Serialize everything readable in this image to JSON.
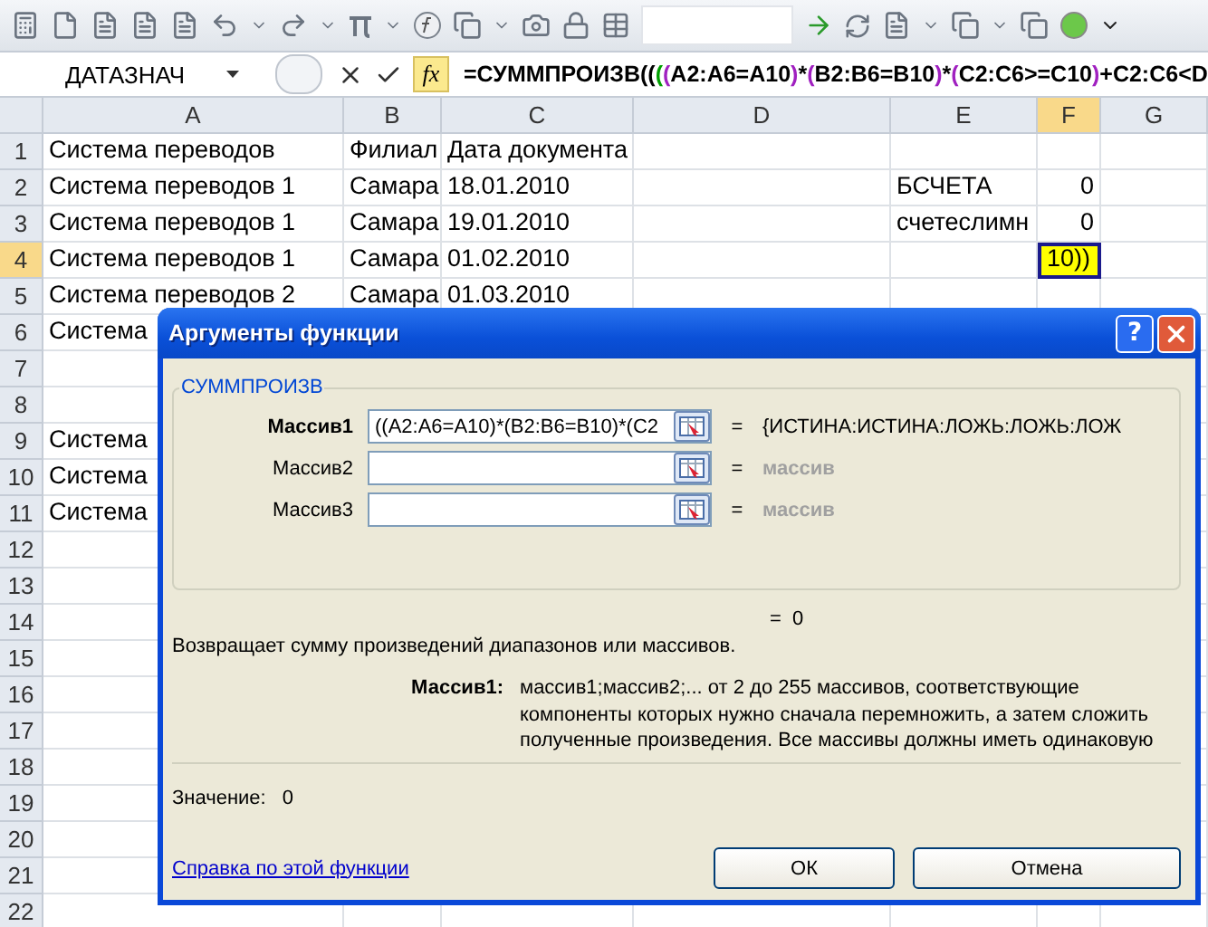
{
  "name_box": {
    "value": "ДАТАЗНАЧ"
  },
  "function_button": "fx",
  "formula": [
    {
      "text": "=СУММПРОИЗВ(",
      "color": "#000000"
    },
    {
      "text": "(",
      "color": "#000000"
    },
    {
      "text": "(",
      "color": "#00a000"
    },
    {
      "text": "(",
      "color": "#a020c0"
    },
    {
      "text": "A2:A6=A10",
      "color": "#000000"
    },
    {
      "text": ")",
      "color": "#a020c0"
    },
    {
      "text": "*",
      "color": "#000000"
    },
    {
      "text": "(",
      "color": "#a020c0"
    },
    {
      "text": "B2:B6=B10",
      "color": "#000000"
    },
    {
      "text": ")",
      "color": "#a020c0"
    },
    {
      "text": "*",
      "color": "#000000"
    },
    {
      "text": "(",
      "color": "#a020c0"
    },
    {
      "text": "C2:C6>=C10",
      "color": "#000000"
    },
    {
      "text": ")",
      "color": "#a020c0"
    },
    {
      "text": "+C2:C6<D",
      "color": "#000000"
    }
  ],
  "columns": [
    {
      "label": "A",
      "selected": false
    },
    {
      "label": "B",
      "selected": false
    },
    {
      "label": "C",
      "selected": false
    },
    {
      "label": "D",
      "selected": false
    },
    {
      "label": "E",
      "selected": false
    },
    {
      "label": "F",
      "selected": true
    },
    {
      "label": "G",
      "selected": false
    }
  ],
  "rows": [
    {
      "number": "1",
      "selected": false,
      "cells": {
        "A": "Система переводов",
        "B": "Филиал",
        "C": "Дата документа"
      }
    },
    {
      "number": "2",
      "selected": false,
      "cells": {
        "A": "Система переводов 1",
        "B": "Самара",
        "C": "18.01.2010",
        "E": "БСЧЕТА",
        "F": "0"
      }
    },
    {
      "number": "3",
      "selected": false,
      "cells": {
        "A": "Система переводов 1",
        "B": "Самара",
        "C": "19.01.2010",
        "E": "счетеслимн",
        "F": "0"
      }
    },
    {
      "number": "4",
      "selected": true,
      "cells": {
        "A": "Система переводов 1",
        "B": "Самара",
        "C": "01.02.2010",
        "F": "10))"
      }
    },
    {
      "number": "5",
      "selected": false,
      "cells": {
        "A": "Система переводов 2",
        "B": "Самара",
        "C": "01.03.2010"
      }
    },
    {
      "number": "6",
      "selected": false,
      "cells": {
        "A": "Система"
      }
    },
    {
      "number": "7",
      "selected": false,
      "cells": {}
    },
    {
      "number": "8",
      "selected": false,
      "cells": {}
    },
    {
      "number": "9",
      "selected": false,
      "cells": {
        "A": "Система"
      }
    },
    {
      "number": "10",
      "selected": false,
      "cells": {
        "A": "Система"
      }
    },
    {
      "number": "11",
      "selected": false,
      "cells": {
        "A": "Система"
      }
    },
    {
      "number": "12",
      "selected": false,
      "cells": {}
    },
    {
      "number": "13",
      "selected": false,
      "cells": {}
    },
    {
      "number": "14",
      "selected": false,
      "cells": {}
    },
    {
      "number": "15",
      "selected": false,
      "cells": {}
    },
    {
      "number": "16",
      "selected": false,
      "cells": {}
    },
    {
      "number": "17",
      "selected": false,
      "cells": {}
    },
    {
      "number": "18",
      "selected": false,
      "cells": {}
    },
    {
      "number": "19",
      "selected": false,
      "cells": {}
    },
    {
      "number": "20",
      "selected": false,
      "cells": {}
    },
    {
      "number": "21",
      "selected": false,
      "cells": {}
    },
    {
      "number": "22",
      "selected": false,
      "cells": {}
    }
  ],
  "dialog": {
    "title": "Аргументы функции",
    "help_button": "?",
    "function_name": "СУММПРОИЗВ",
    "arguments": [
      {
        "name": "Массив1",
        "active": true,
        "value": "((A2:A6=A10)*(B2:B6=B10)*(C2",
        "equals": "=",
        "result": "{ИСТИНА:ИСТИНА:ЛОЖЬ:ЛОЖЬ:ЛОЖ"
      },
      {
        "name": "Массив2",
        "active": false,
        "equals": "=",
        "result": "массив"
      },
      {
        "name": "Массив3",
        "active": false,
        "equals": "=",
        "result": "массив"
      }
    ],
    "formula_result": "=  0",
    "description": "Возвращает сумму произведений диапазонов или массивов.",
    "argument_help_label": "Массив1:",
    "argument_help": "массив1;массив2;... от 2 до 255 массивов, соответствующие компоненты которых нужно сначала перемножить, а затем сложить полученные произведения. Все массивы должны иметь одинаковую",
    "value_label": "Значение:",
    "value": "0",
    "help_link": "Справка по этой функции",
    "buttons": [
      "ОК",
      "Отмена"
    ]
  }
}
